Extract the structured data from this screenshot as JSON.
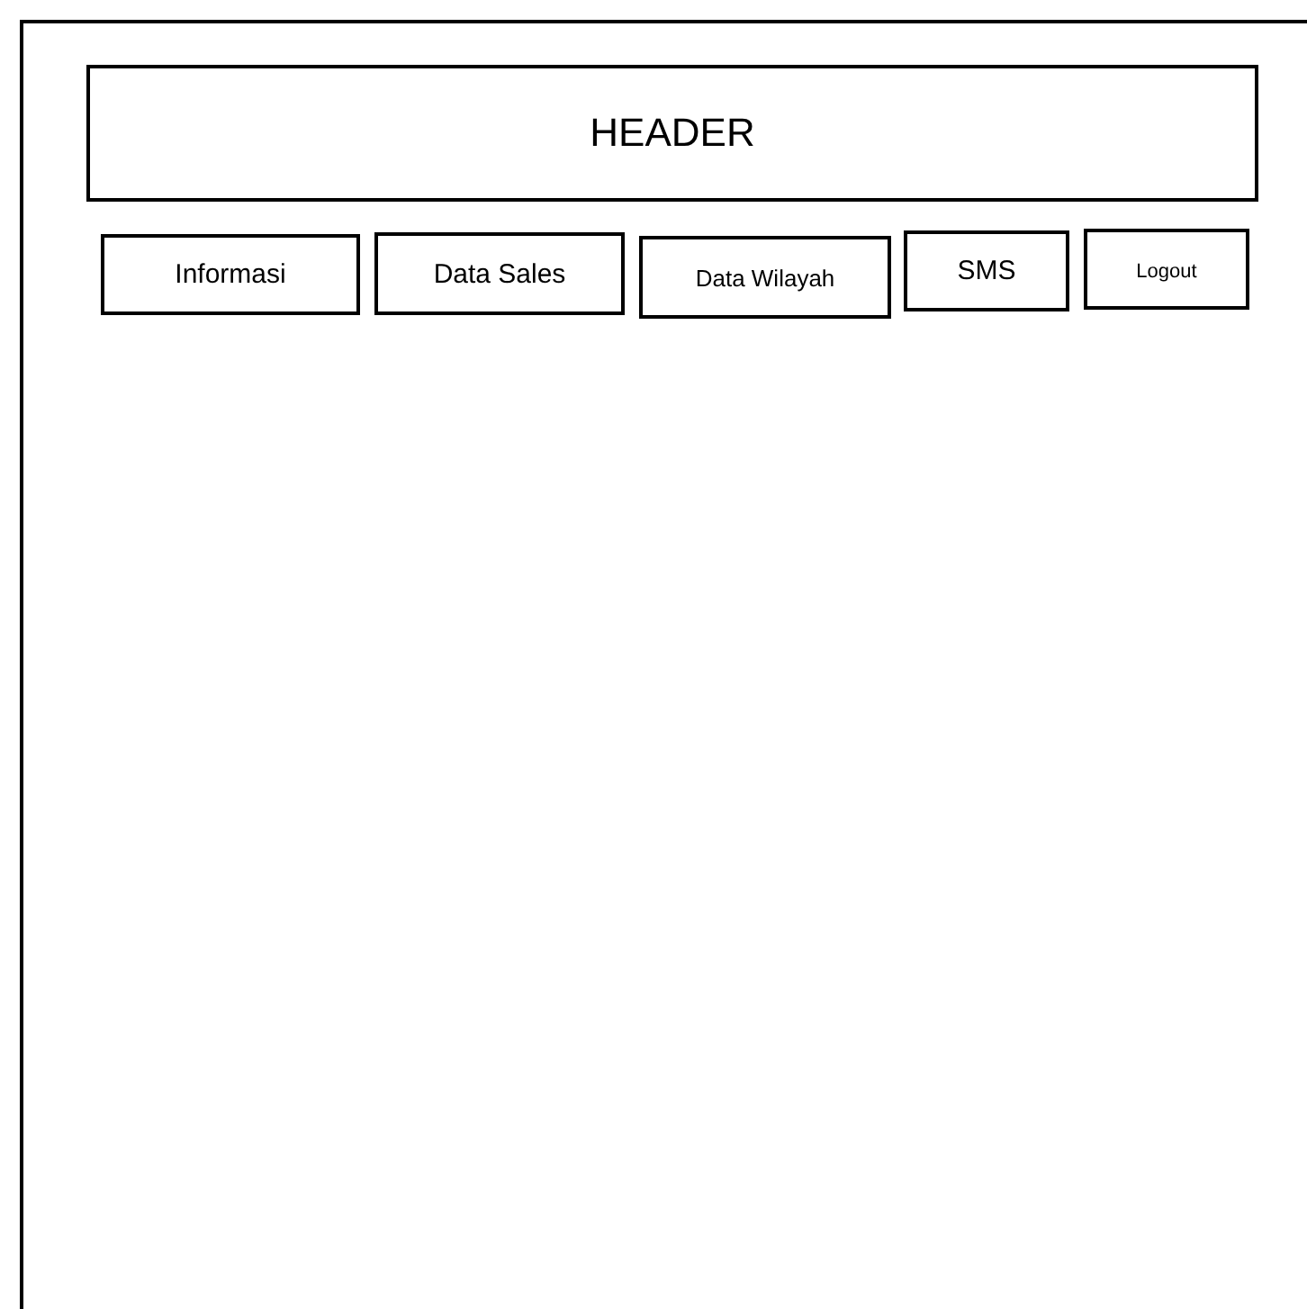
{
  "header": {
    "title": "HEADER"
  },
  "menu": [
    {
      "label": "Informasi"
    },
    {
      "label": "Data Sales"
    },
    {
      "label": "Data Wilayah"
    },
    {
      "label": "SMS"
    },
    {
      "label": "Logout"
    }
  ]
}
